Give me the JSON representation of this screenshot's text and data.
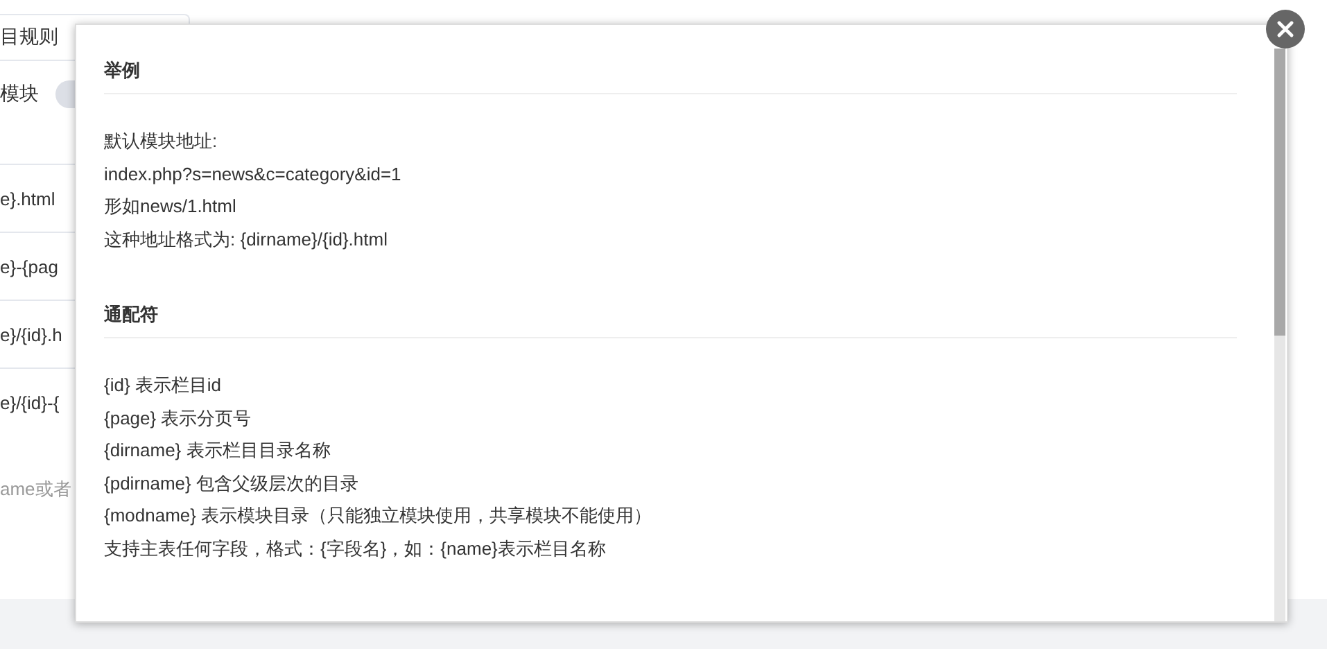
{
  "background": {
    "rule_field": "目规则",
    "module_label": "模块",
    "module_toggle": {
      "on": false
    },
    "url_fields": [
      "e}.html",
      "e}-{pag",
      "e}/{id}.h",
      "e}/{id}-{"
    ],
    "hint": "ame或者"
  },
  "dialog": {
    "sections": [
      {
        "title": "举例",
        "lines": [
          "默认模块地址:",
          "index.php?s=news&c=category&id=1",
          "形如news/1.html",
          "这种地址格式为: {dirname}/{id}.html"
        ]
      },
      {
        "title": "通配符",
        "lines": [
          "{id} 表示栏目id",
          "{page} 表示分页号",
          "{dirname} 表示栏目目录名称",
          "{pdirname} 包含父级层次的目录",
          "{modname} 表示模块目录（只能独立模块使用，共享模块不能使用）",
          "支持主表任何字段，格式：{字段名}，如：{name}表示栏目名称"
        ]
      }
    ]
  }
}
